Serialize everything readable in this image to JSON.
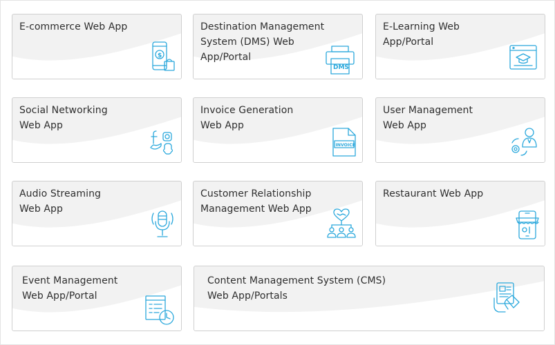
{
  "cards": [
    {
      "title": "E-commerce Web App",
      "icon": "mobile-shopping-icon"
    },
    {
      "title": "Destination Management\nSystem (DMS) Web\nApp/Portal",
      "icon": "dms-printer-icon",
      "icon_text": "DMS"
    },
    {
      "title": "E-Learning Web\nApp/Portal",
      "icon": "graduation-browser-icon"
    },
    {
      "title": "Social Networking\nWeb App",
      "icon": "social-media-icon"
    },
    {
      "title": "Invoice Generation\nWeb App",
      "icon": "invoice-document-icon",
      "icon_text": "INVOICE"
    },
    {
      "title": "User Management\nWeb App",
      "icon": "user-settings-icon"
    },
    {
      "title": "Audio Streaming\nWeb App",
      "icon": "microphone-icon"
    },
    {
      "title": "Customer Relationship\nManagement Web App",
      "icon": "crm-handshake-icon"
    },
    {
      "title": "Restaurant Web App",
      "icon": "restaurant-mobile-icon"
    },
    {
      "title": "Event Management\nWeb App/Portal",
      "icon": "event-clock-icon"
    },
    {
      "title": "Content Management System (CMS)\nWeb App/Portals",
      "icon": "cms-touch-icon"
    }
  ],
  "colors": {
    "accent": "#2aa8dc",
    "card_bg": "#f2f2f2",
    "text": "#2e2e2e"
  }
}
